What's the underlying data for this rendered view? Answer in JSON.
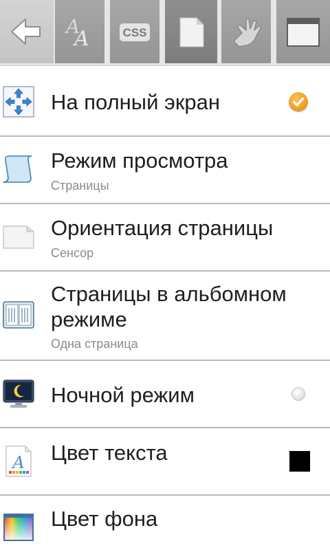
{
  "toolbar": {
    "buttons": [
      {
        "name": "back-arrow-icon"
      },
      {
        "name": "font-icon"
      },
      {
        "name": "css-icon",
        "label": "CSS"
      },
      {
        "name": "page-icon"
      },
      {
        "name": "gesture-hand-icon"
      },
      {
        "name": "window-icon"
      }
    ]
  },
  "settings": [
    {
      "title": "На полный экран",
      "control": "checkbox",
      "checked": true,
      "icon": "fullscreen-arrows-icon"
    },
    {
      "title": "Режим просмотра",
      "subtitle": "Страницы",
      "icon": "scroll-icon"
    },
    {
      "title": "Ориентация страницы",
      "subtitle": "Сенсор",
      "icon": "page-orientation-icon"
    },
    {
      "title_line1": "Страницы в альбомном",
      "title_line2": "режиме",
      "subtitle": "Одна страница",
      "icon": "two-pages-icon"
    },
    {
      "title": "Ночной режим",
      "control": "radio",
      "checked": false,
      "icon": "night-monitor-icon"
    },
    {
      "title": "Цвет текста",
      "control": "color-swatch",
      "color": "#000000",
      "icon": "text-color-icon"
    },
    {
      "title": "Цвет фона",
      "icon": "background-color-icon"
    }
  ],
  "colors": {
    "accent": "#f2a325",
    "divider": "#b9b9b9",
    "text_color_value": "#000000"
  }
}
